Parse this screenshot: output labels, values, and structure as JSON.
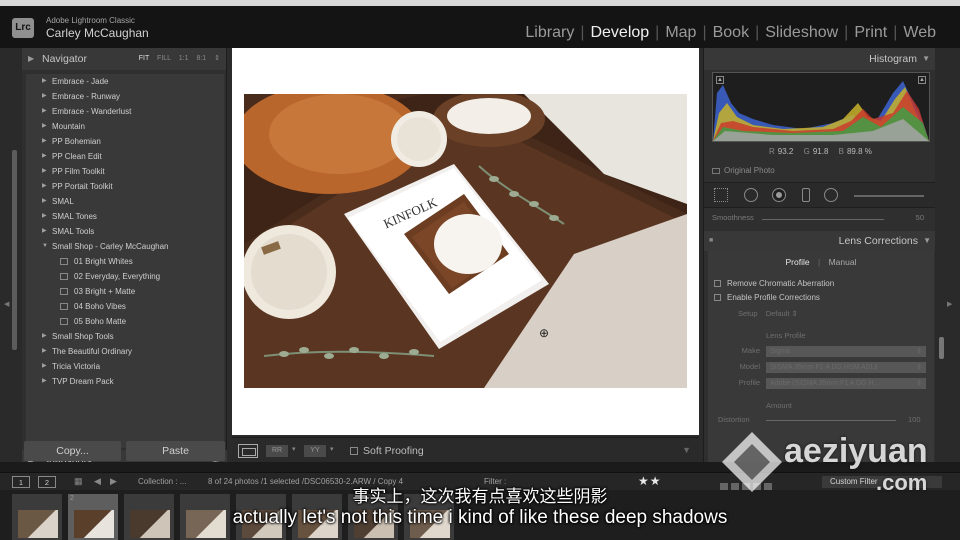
{
  "app": {
    "name": "Adobe Lightroom Classic",
    "user": "Carley McCaughan",
    "logo": "Lrc"
  },
  "modules": [
    {
      "label": "Library",
      "active": false
    },
    {
      "label": "Develop",
      "active": true
    },
    {
      "label": "Map",
      "active": false
    },
    {
      "label": "Book",
      "active": false
    },
    {
      "label": "Slideshow",
      "active": false
    },
    {
      "label": "Print",
      "active": false
    },
    {
      "label": "Web",
      "active": false
    }
  ],
  "left": {
    "navigator": {
      "title": "Navigator",
      "zoom": [
        "FIT",
        "FILL",
        "1:1",
        "8:1"
      ],
      "zoom_selected": "FIT"
    },
    "presets": [
      {
        "label": "Embrace - Jade",
        "sub": false
      },
      {
        "label": "Embrace - Runway",
        "sub": false
      },
      {
        "label": "Embrace - Wanderlust",
        "sub": false
      },
      {
        "label": "Mountain",
        "sub": false
      },
      {
        "label": "PP Bohemian",
        "sub": false
      },
      {
        "label": "PP Clean Edit",
        "sub": false
      },
      {
        "label": "PP Film Toolkit",
        "sub": false
      },
      {
        "label": "PP Portait Toolkit",
        "sub": false
      },
      {
        "label": "SMAL",
        "sub": false
      },
      {
        "label": "SMAL Tones",
        "sub": false
      },
      {
        "label": "SMAL Tools",
        "sub": false
      },
      {
        "label": "Small Shop - Carley McCaughan",
        "sub": false,
        "expanded": true
      },
      {
        "label": "01 Bright Whites",
        "sub": true
      },
      {
        "label": "02 Everyday, Everything",
        "sub": true
      },
      {
        "label": "03 Bright + Matte",
        "sub": true
      },
      {
        "label": "04 Boho Vibes",
        "sub": true
      },
      {
        "label": "05 Boho Matte",
        "sub": true
      },
      {
        "label": "Small Shop Tools",
        "sub": false
      },
      {
        "label": "The Beautiful Ordinary",
        "sub": false
      },
      {
        "label": "Tricia Victoria",
        "sub": false
      },
      {
        "label": "TVP Dream Pack",
        "sub": false
      }
    ],
    "snapshots": "Snapshots",
    "copy_button": "Copy...",
    "paste_button": "Paste"
  },
  "toolbar": {
    "soft_proofing": "Soft Proofing"
  },
  "right": {
    "histogram": {
      "title": "Histogram",
      "r_label": "R",
      "r_value": "93.2",
      "g_label": "G",
      "g_value": "91.8",
      "b_label": "B",
      "b_value": "89.8",
      "pct": "%",
      "original_photo": "Original Photo"
    },
    "smoothness": {
      "label": "Smoothness",
      "value": "50"
    },
    "lens": {
      "title": "Lens Corrections",
      "tabs": [
        "Profile",
        "Manual"
      ],
      "active_tab": "Profile",
      "remove_ca": "Remove Chromatic Aberration",
      "enable_profile": "Enable Profile Corrections",
      "setup_label": "Setup",
      "setup_value": "Default ⇕",
      "lens_profile": "Lens Profile",
      "make_label": "Make",
      "make_value": "Sigma",
      "model_label": "Model",
      "model_value": "SIGMA 35mm F1.4 DG HSM A013",
      "profile_label": "Profile",
      "profile_value": "Adobe (SIGMA 35mm F1.4 DG H...",
      "amount": "Amount",
      "distortion_label": "Distortion",
      "distortion_value": "100"
    }
  },
  "filmstrip": {
    "pages": [
      "1",
      "2"
    ],
    "collection": "Collection : ...",
    "photo_info": "8 of 24 photos /1 selected /DSC06530-2.ARW / Copy 4",
    "filter_label": "Filter :",
    "rating_stars": 2,
    "custom_filter": "Custom Filter",
    "thumbs": [
      {
        "num": "",
        "colors": [
          "#6b5844",
          "#d9d3c9"
        ]
      },
      {
        "num": "2",
        "colors": [
          "#5a3f2b",
          "#e8e3dc"
        ]
      },
      {
        "num": "",
        "colors": [
          "#4a3a2e",
          "#cfc4b8"
        ]
      },
      {
        "num": "",
        "colors": [
          "#776655",
          "#e3dcd1"
        ]
      },
      {
        "num": "",
        "colors": [
          "#5c4a3c",
          "#d2c9bd"
        ]
      },
      {
        "num": "",
        "colors": [
          "#67513f",
          "#ddd5ca"
        ]
      },
      {
        "num": "",
        "colors": [
          "#4f3f33",
          "#cbbfb1"
        ]
      },
      {
        "num": "",
        "colors": [
          "#6e5d4d",
          "#e0d8cd"
        ]
      }
    ]
  },
  "subtitles": {
    "zh": "事实上，这次我有点喜欢这些阴影",
    "en": "actually let's not this time i kind of like these deep shadows"
  },
  "watermark": {
    "line1": "aeziyuan",
    "line2": ".com"
  }
}
